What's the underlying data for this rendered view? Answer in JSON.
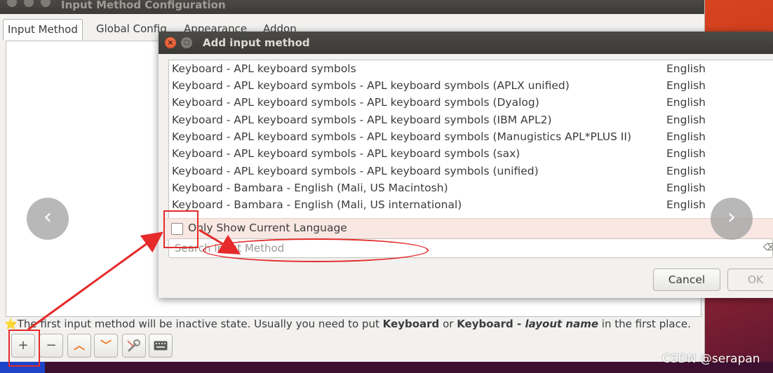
{
  "main_window": {
    "title": "Input Method Configuration",
    "tabs": [
      "Input Method",
      "Global Config",
      "Appearance",
      "Addon"
    ],
    "hint": {
      "star": "⭐",
      "part1": "The first input method will be inactive state. Usually you need to put ",
      "bold1": "Keyboard",
      "part2": " or ",
      "bold2": "Keyboard - ",
      "italic": "layout name",
      "part3": " in the first place."
    },
    "toolbar": {
      "add": "+",
      "remove": "−",
      "up": "︿",
      "down": "﹀",
      "configure_icon": "wrench-icon",
      "keyboard_icon": "keyboard-icon"
    }
  },
  "dialog": {
    "title": "Add input method",
    "items": [
      {
        "name": "Keyboard - APL keyboard symbols",
        "lang": "English"
      },
      {
        "name": "Keyboard - APL keyboard symbols - APL keyboard symbols (APLX unified)",
        "lang": "English"
      },
      {
        "name": "Keyboard - APL keyboard symbols - APL keyboard symbols (Dyalog)",
        "lang": "English"
      },
      {
        "name": "Keyboard - APL keyboard symbols - APL keyboard symbols (IBM APL2)",
        "lang": "English"
      },
      {
        "name": "Keyboard - APL keyboard symbols - APL keyboard symbols (Manugistics APL*PLUS II)",
        "lang": "English"
      },
      {
        "name": "Keyboard - APL keyboard symbols - APL keyboard symbols (sax)",
        "lang": "English"
      },
      {
        "name": "Keyboard - APL keyboard symbols - APL keyboard symbols (unified)",
        "lang": "English"
      },
      {
        "name": "Keyboard - Bambara - English (Mali, US Macintosh)",
        "lang": "English"
      },
      {
        "name": "Keyboard - Bambara - English (Mali, US international)",
        "lang": "English"
      }
    ],
    "only_current_language": "Only Show Current Language",
    "search_placeholder": "Search Input Method",
    "cancel": "Cancel",
    "ok": "OK"
  },
  "watermark": "CSDN @serapan",
  "colors": {
    "annotation": "#e62a2a",
    "accent_orange": "#f0781c",
    "close_button": "#df4a1f"
  }
}
